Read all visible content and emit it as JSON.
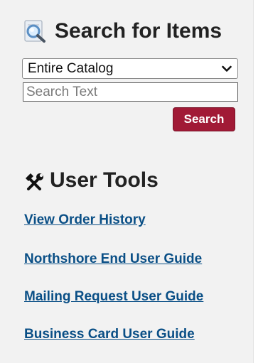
{
  "search": {
    "title": "Search for Items",
    "scope_selected": "Entire Catalog",
    "placeholder": "Search Text",
    "button_label": "Search"
  },
  "tools": {
    "title": "User Tools",
    "links": [
      {
        "label": "View Order History"
      },
      {
        "label": "Northshore End User Guide"
      },
      {
        "label": "Mailing Request User Guide"
      },
      {
        "label": "Business Card User Guide"
      }
    ]
  },
  "colors": {
    "panel_background": "#f2f2f2",
    "button_background": "#a11a36",
    "link": "#0a4f86",
    "heading": "#222222"
  },
  "icons": {
    "search_heading": "magnifying-glass-icon",
    "scope_dropdown": "chevron-down-icon",
    "tools_heading": "tools-icon"
  }
}
